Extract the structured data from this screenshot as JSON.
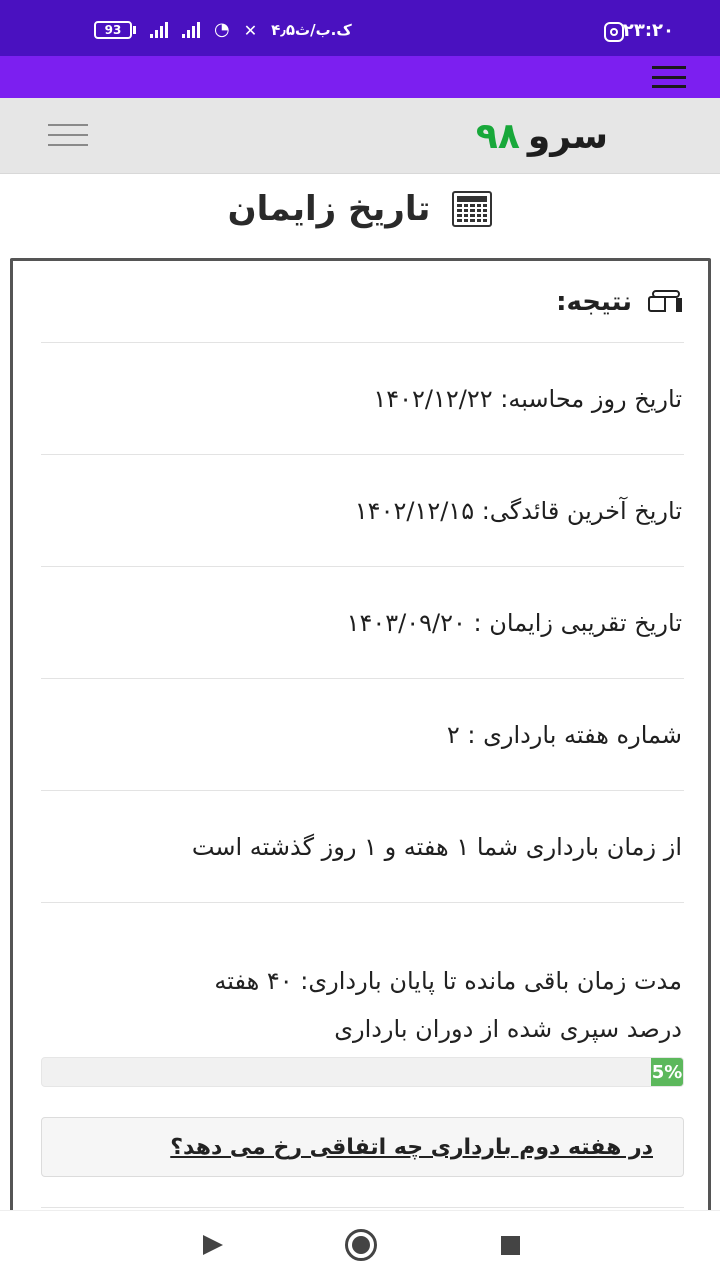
{
  "status_bar": {
    "time": "۲۳:۲۰",
    "speed": "۴٫۵ک.ب/ث",
    "battery": "93",
    "icons": [
      "instagram-icon",
      "mute-icon",
      "wifi-icon",
      "signal-icon",
      "battery-icon"
    ]
  },
  "site": {
    "logo_text": "سرو",
    "logo_number": "۹۸",
    "logo_number_color": "#18a83a"
  },
  "page": {
    "title": "تاریخ زایمان"
  },
  "result": {
    "heading": "نتیجه:",
    "rows": [
      "تاریخ روز محاسبه: ۱۴۰۲/۱۲/۲۲",
      "تاریخ آخرین قائدگی: ۱۴۰۲/۱۲/۱۵",
      "تاریخ تقریبی زایمان : ۱۴۰۳/۰۹/۲۰",
      "شماره هفته بارداری : ۲",
      "از زمان بارداری شما ۱ هفته و ۱ روز گذشته است"
    ],
    "remaining": "مدت زمان باقی مانده تا پایان بارداری: ۴۰ هفته",
    "progress_label": "درصد سپری شده از دوران بارداری",
    "progress_value": 5,
    "progress_text": "5%",
    "progress_color": "#5cb85c",
    "link_text": "در هفته دوم بارداری چه اتفاقی رخ می دهد؟"
  },
  "colors": {
    "status_bar": "#4a11c0",
    "app_bar": "#7c1ff0",
    "header_bg": "#e6e6e6"
  }
}
